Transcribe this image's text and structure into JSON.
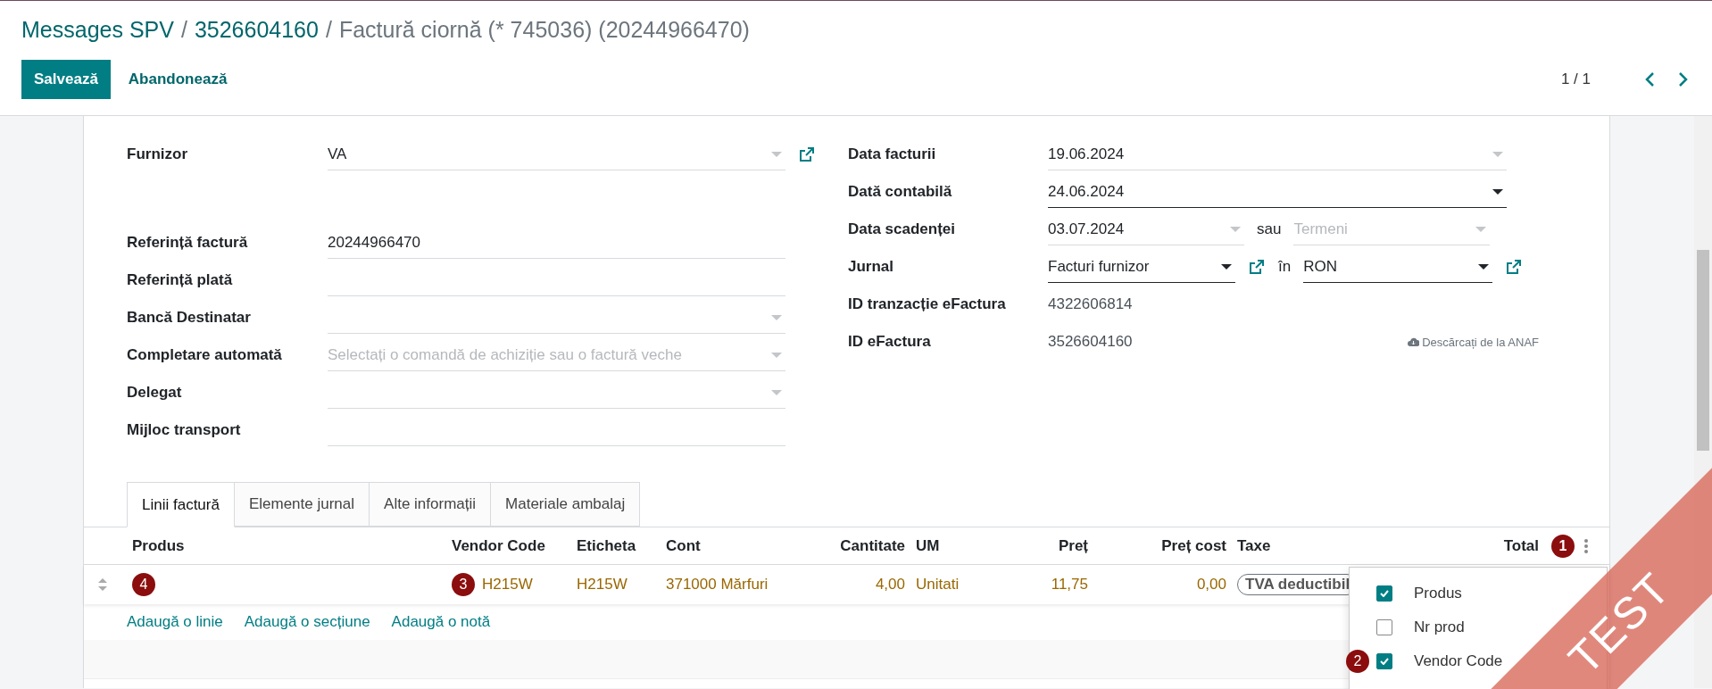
{
  "breadcrumbs": [
    {
      "label": "Messages SPV",
      "kind": "link"
    },
    {
      "label": "3526604160",
      "kind": "link"
    },
    {
      "label": "Factură ciornă (* 745036) (20244966470)",
      "kind": "current"
    }
  ],
  "actions": {
    "save": "Salvează",
    "discard": "Abandonează"
  },
  "breadcrumb_separator": "/",
  "pager": {
    "label": "1 / 1"
  },
  "form": {
    "partner": {
      "label": "Furnizor",
      "value": "VA",
      "kind": "dropdown",
      "external_link": true
    },
    "left_fields": [
      {
        "label": "Referință factură",
        "value": "20244966470",
        "kind": "text"
      },
      {
        "label": "Referință plată",
        "kind": "text"
      },
      {
        "label": "Bancă Destinatar",
        "kind": "dropdown"
      },
      {
        "label": "Completare automată",
        "placeholder": "Selectați o comandă de achiziție sau o factură veche",
        "kind": "dropdown"
      },
      {
        "label": "Delegat",
        "kind": "dropdown"
      },
      {
        "label": "Mijloc transport",
        "kind": "text"
      }
    ],
    "right_fields": [
      {
        "label": "Data facturii",
        "kind": "date",
        "value": "19.06.2024",
        "active": false
      },
      {
        "label": "Dată contabilă",
        "kind": "date",
        "value": "24.06.2024",
        "active": true
      },
      {
        "label": "Data scadenței",
        "kind": "date_pair",
        "value": "03.07.2024",
        "joiner": "sau",
        "second_placeholder": "Termeni",
        "active": false
      },
      {
        "label": "Jurnal",
        "kind": "journal",
        "value": "Facturi furnizor",
        "joiner": "în",
        "second_value": "RON",
        "active": true
      },
      {
        "label": "ID tranzacție eFactura",
        "kind": "readonly",
        "value": "4322606814"
      },
      {
        "label": "ID eFactura",
        "kind": "readonly",
        "value": "3526604160",
        "action": "Descărcați de la ANAF"
      }
    ]
  },
  "tabs": [
    {
      "label": "Linii factură",
      "selected": true
    },
    {
      "label": "Elemente jurnal",
      "selected": false
    },
    {
      "label": "Alte informații",
      "selected": false
    },
    {
      "label": "Materiale ambalaj",
      "selected": false
    }
  ],
  "table": {
    "columns": [
      {
        "label": "Produs",
        "numeric": false
      },
      {
        "label": "Vendor Code",
        "numeric": false
      },
      {
        "label": "Eticheta",
        "numeric": false
      },
      {
        "label": "Cont",
        "numeric": false
      },
      {
        "label": "Cantitate",
        "numeric": true
      },
      {
        "label": "UM",
        "numeric": false
      },
      {
        "label": "Preț",
        "numeric": true
      },
      {
        "label": "Preț cost",
        "numeric": true
      },
      {
        "label": "Taxe",
        "numeric": false
      },
      {
        "label": "Total",
        "numeric": true
      }
    ],
    "options_callout": "1",
    "rows": [
      {
        "cells": [
          {
            "callout": "4"
          },
          {
            "kind": "text",
            "value": "H215W",
            "callout": "3"
          },
          {
            "kind": "text",
            "value": "H215W"
          },
          {
            "kind": "text",
            "value": "371000 Mărfuri"
          },
          {
            "kind": "text",
            "value": "4,00"
          },
          {
            "kind": "text",
            "value": "Unitati"
          },
          {
            "kind": "text",
            "value": "11,75"
          },
          {
            "kind": "text",
            "value": "0,00"
          },
          {
            "kind": "tag",
            "value": "TVA deductibil"
          }
        ]
      }
    ],
    "add_links": [
      "Adaugă o linie",
      "Adaugă o secțiune",
      "Adaugă o notă"
    ]
  },
  "column_menu": {
    "items": [
      {
        "label": "Produs",
        "checked": true
      },
      {
        "label": "Nr prod",
        "checked": false
      },
      {
        "label": "Vendor Code",
        "checked": true,
        "callout": "2"
      }
    ]
  },
  "ribbon": {
    "label": "TEST"
  }
}
